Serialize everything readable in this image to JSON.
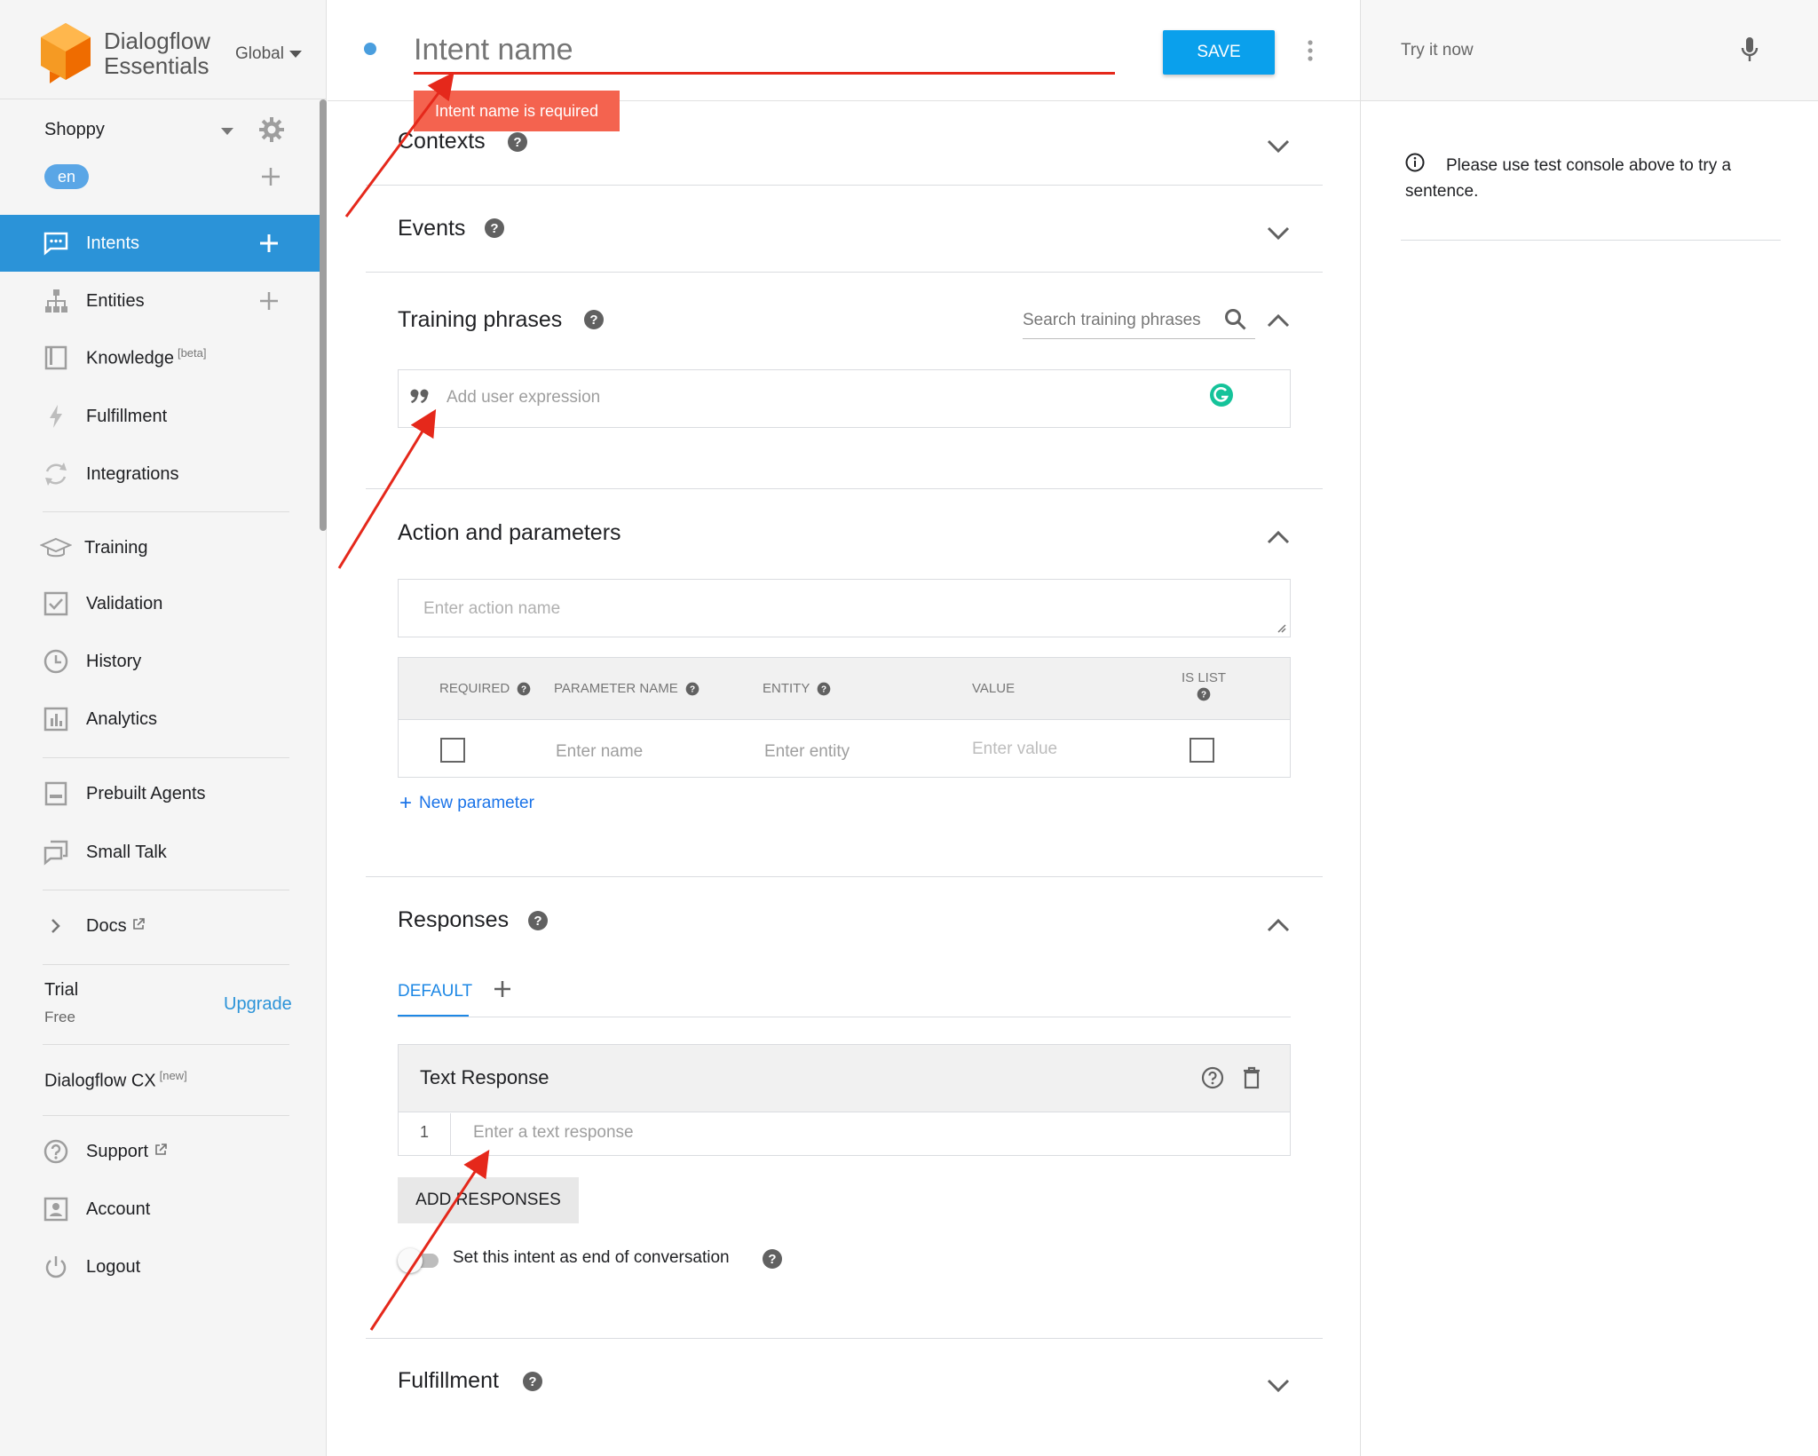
{
  "brand": {
    "name_line1": "Dialogflow",
    "name_line2": "Essentials",
    "region": "Global"
  },
  "agent": {
    "name": "Shoppy",
    "language": "en"
  },
  "sidebar": {
    "items": [
      {
        "label": "Intents",
        "active": true
      },
      {
        "label": "Entities"
      },
      {
        "label": "Knowledge",
        "sup": "[beta]"
      },
      {
        "label": "Fulfillment"
      },
      {
        "label": "Integrations"
      },
      {
        "label": "Training"
      },
      {
        "label": "Validation"
      },
      {
        "label": "History"
      },
      {
        "label": "Analytics"
      },
      {
        "label": "Prebuilt Agents"
      },
      {
        "label": "Small Talk"
      },
      {
        "label": "Docs"
      },
      {
        "label": "Support"
      },
      {
        "label": "Account"
      },
      {
        "label": "Logout"
      }
    ],
    "trial": {
      "title": "Trial",
      "plan": "Free",
      "upgrade": "Upgrade"
    },
    "cx": {
      "label": "Dialogflow CX",
      "sup": "[new]"
    }
  },
  "header": {
    "intent_placeholder": "Intent name",
    "save_label": "SAVE",
    "error": "Intent name is required"
  },
  "sections": {
    "contexts": "Contexts",
    "events": "Events",
    "training": {
      "title": "Training phrases",
      "search_placeholder": "Search training phrases",
      "expression_placeholder": "Add user expression"
    },
    "action": {
      "title": "Action and parameters",
      "action_placeholder": "Enter action name",
      "columns": [
        "REQUIRED",
        "PARAMETER NAME",
        "ENTITY",
        "VALUE",
        "IS LIST"
      ],
      "row": {
        "name": "Enter name",
        "entity": "Enter entity",
        "value": "Enter value"
      },
      "new_parameter": "New parameter"
    },
    "responses": {
      "title": "Responses",
      "tab": "DEFAULT",
      "text_response_title": "Text Response",
      "line_number": "1",
      "text_placeholder": "Enter a text response",
      "add_responses": "ADD RESPONSES",
      "end_conversation": "Set this intent as end of conversation"
    },
    "fulfillment": "Fulfillment"
  },
  "right_panel": {
    "try_placeholder": "Try it now",
    "info": "Please use test console above to try a sentence."
  },
  "colors": {
    "accent": "#2b93d8",
    "save": "#0aa0ec",
    "error": "#f4634f",
    "arrow": "#e5281b"
  }
}
